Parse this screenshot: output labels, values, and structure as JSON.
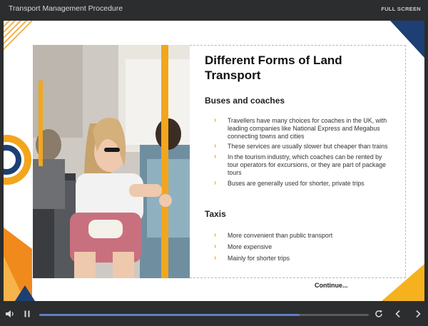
{
  "window": {
    "title": "Transport Management Procedure",
    "fullscreen_label": "FULL SCREEN"
  },
  "slide": {
    "heading": "Different Forms of Land Transport",
    "sections": [
      {
        "title": "Buses and coaches",
        "bullets": [
          "Travellers have many choices for coaches in the UK, with leading companies like National Express and Megabus connecting towns and cities",
          "These services are usually slower but cheaper than trains",
          "In the tourism industry, which coaches can be rented by tour operators for excursions, or they are part of package tours",
          "Buses are generally used for shorter, private trips"
        ]
      },
      {
        "title": "Taxis",
        "bullets": [
          "More convenient than public transport",
          "More expensive",
          "Mainly for shorter trips"
        ]
      }
    ],
    "continue_label": "Continue..."
  },
  "player": {
    "progress_percent": 79,
    "icons": {
      "volume": "volume-icon",
      "pause": "pause-icon",
      "replay": "replay-icon",
      "prev": "chevron-left-icon",
      "next": "chevron-right-icon",
      "bullet": "chevron-right-bullet-icon"
    }
  },
  "colors": {
    "accent_yellow": "#f3a51d",
    "accent_orange": "#f08a1c",
    "navy": "#1d3f73",
    "progress_fill": "#5f7fc4",
    "player_bg": "#2b2d2f"
  }
}
